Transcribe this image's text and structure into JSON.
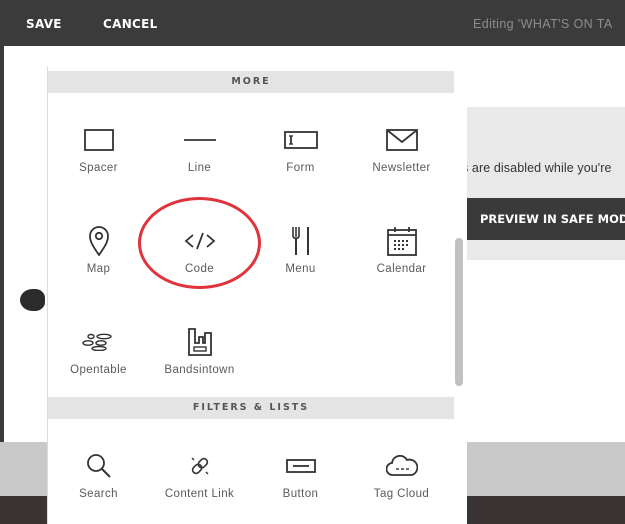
{
  "topbar": {
    "save_label": "SAVE",
    "cancel_label": "CANCEL",
    "editing_text": "Editing 'WHAT'S ON TA"
  },
  "page": {
    "disabled_text": "s are disabled while you're",
    "preview_label": "PREVIEW IN SAFE MODE"
  },
  "panel": {
    "more_header": "MORE",
    "filters_header": "FILTERS & LISTS",
    "more_blocks": [
      {
        "label": "Spacer",
        "icon": "spacer-icon"
      },
      {
        "label": "Line",
        "icon": "line-icon"
      },
      {
        "label": "Form",
        "icon": "form-icon"
      },
      {
        "label": "Newsletter",
        "icon": "envelope-icon"
      },
      {
        "label": "Map",
        "icon": "map-pin-icon"
      },
      {
        "label": "Code",
        "icon": "code-icon"
      },
      {
        "label": "Menu",
        "icon": "fork-knife-icon"
      },
      {
        "label": "Calendar",
        "icon": "calendar-icon"
      },
      {
        "label": "Opentable",
        "icon": "opentable-icon"
      },
      {
        "label": "Bandsintown",
        "icon": "bandsintown-icon"
      }
    ],
    "filter_blocks": [
      {
        "label": "Search",
        "icon": "magnifier-icon"
      },
      {
        "label": "Content Link",
        "icon": "link-icon"
      },
      {
        "label": "Button",
        "icon": "button-icon"
      },
      {
        "label": "Tag Cloud",
        "icon": "cloud-icon"
      }
    ]
  },
  "colors": {
    "annotation": "#e0333b",
    "topbar": "#3c3b3b",
    "header_bg": "#e4e4e4"
  }
}
